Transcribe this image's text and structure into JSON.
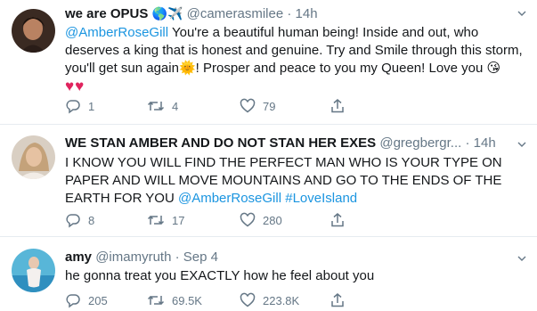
{
  "tweets": [
    {
      "name": "we are OPUS",
      "name_emoji": "🌎✈️",
      "handle": "@camerasmilee",
      "sep": "·",
      "time": "14h",
      "mention": "@AmberRoseGill",
      "text_1": " You're a beautiful human being! Inside and out, who deserves a king that is honest and genuine. Try and Smile through this storm, you'll get sun again",
      "emoji_sun": "🌞",
      "text_2": "! Prosper and peace to you my Queen!  Love you ",
      "emoji_kiss": "😘",
      "hearts": "♥♥",
      "replies": "1",
      "retweets": "4",
      "likes": "79"
    },
    {
      "name": "WE STAN AMBER AND DO NOT STAN HER EXES",
      "handle": "@gregbergr...",
      "sep": "·",
      "time": "14h",
      "text": "I KNOW YOU WILL FIND THE PERFECT MAN WHO IS YOUR TYPE ON PAPER AND WILL MOVE MOUNTAINS AND GO TO THE ENDS OF THE EARTH FOR YOU ",
      "mention": "@AmberRoseGill",
      "hashtag": "#LoveIsland",
      "replies": "8",
      "retweets": "17",
      "likes": "280"
    },
    {
      "name": "amy",
      "handle": "@imamyruth",
      "sep": "·",
      "time": "Sep 4",
      "text": "he gonna treat you EXACTLY how he feel about you",
      "replies": "205",
      "retweets": "69.5K",
      "likes": "223.8K"
    }
  ],
  "colors": {
    "link": "#1b95e0",
    "muted": "#657786",
    "heart": "#e0245e"
  },
  "icons": [
    "reply-icon",
    "retweet-icon",
    "like-icon",
    "share-icon",
    "chevron-down-icon"
  ]
}
